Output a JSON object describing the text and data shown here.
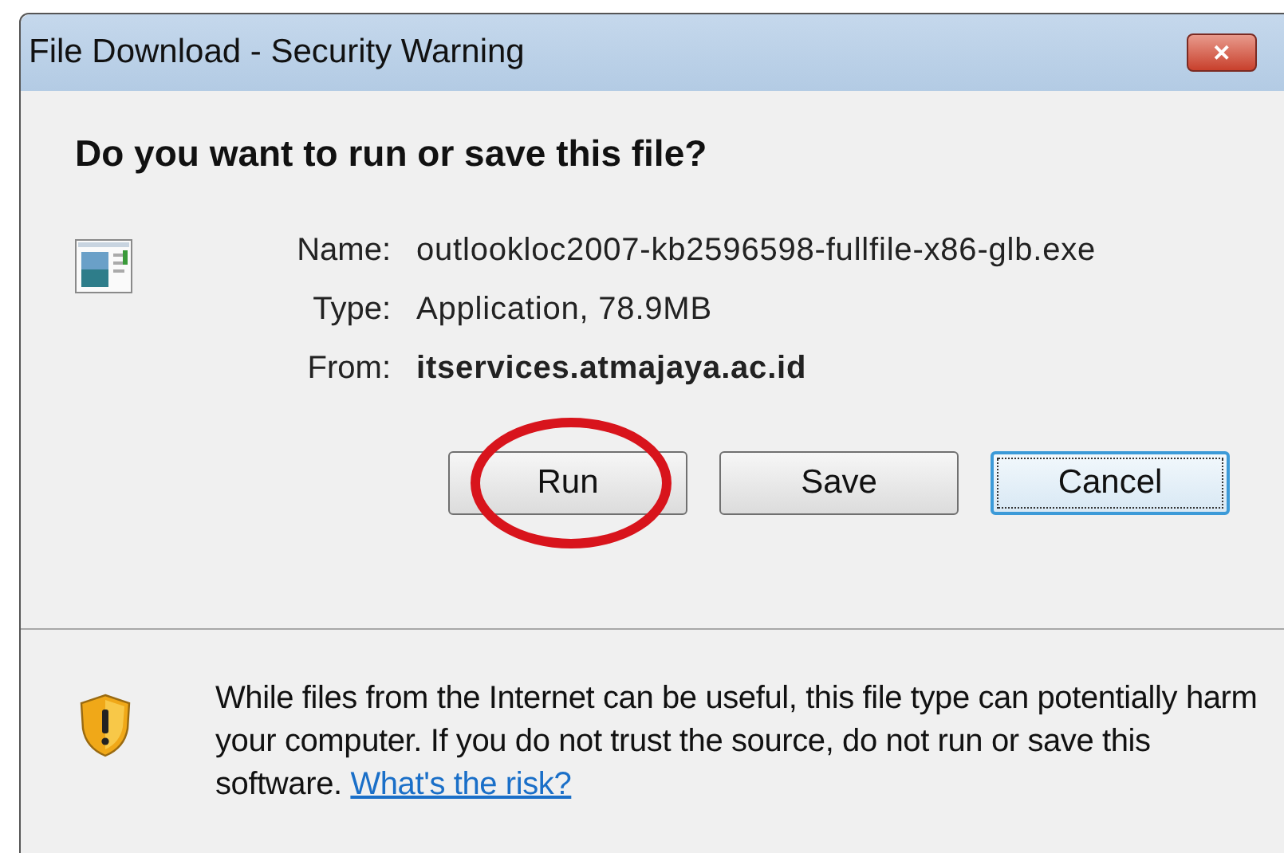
{
  "window": {
    "title": "File Download - Security Warning",
    "close": "✕"
  },
  "heading": "Do you want to run or save this file?",
  "file_info": [
    {
      "label": "Name:",
      "value": "outlookloc2007-kb2596598-fullfile-x86-glb.exe",
      "bold": false
    },
    {
      "label": "Type:",
      "value": "Application, 78.9MB",
      "bold": false
    },
    {
      "label": "From:",
      "value": "itservices.atmajaya.ac.id",
      "bold": true
    }
  ],
  "buttons": [
    {
      "label": "Run",
      "focused": false,
      "circled": true
    },
    {
      "label": "Save",
      "focused": false,
      "circled": false
    },
    {
      "label": "Cancel",
      "focused": true,
      "circled": false
    }
  ],
  "warning": {
    "text": "While files from the Internet can be useful, this file type can potentially harm your computer. If you do not trust the source, do not run or save this software.",
    "link": "What's the risk?"
  }
}
